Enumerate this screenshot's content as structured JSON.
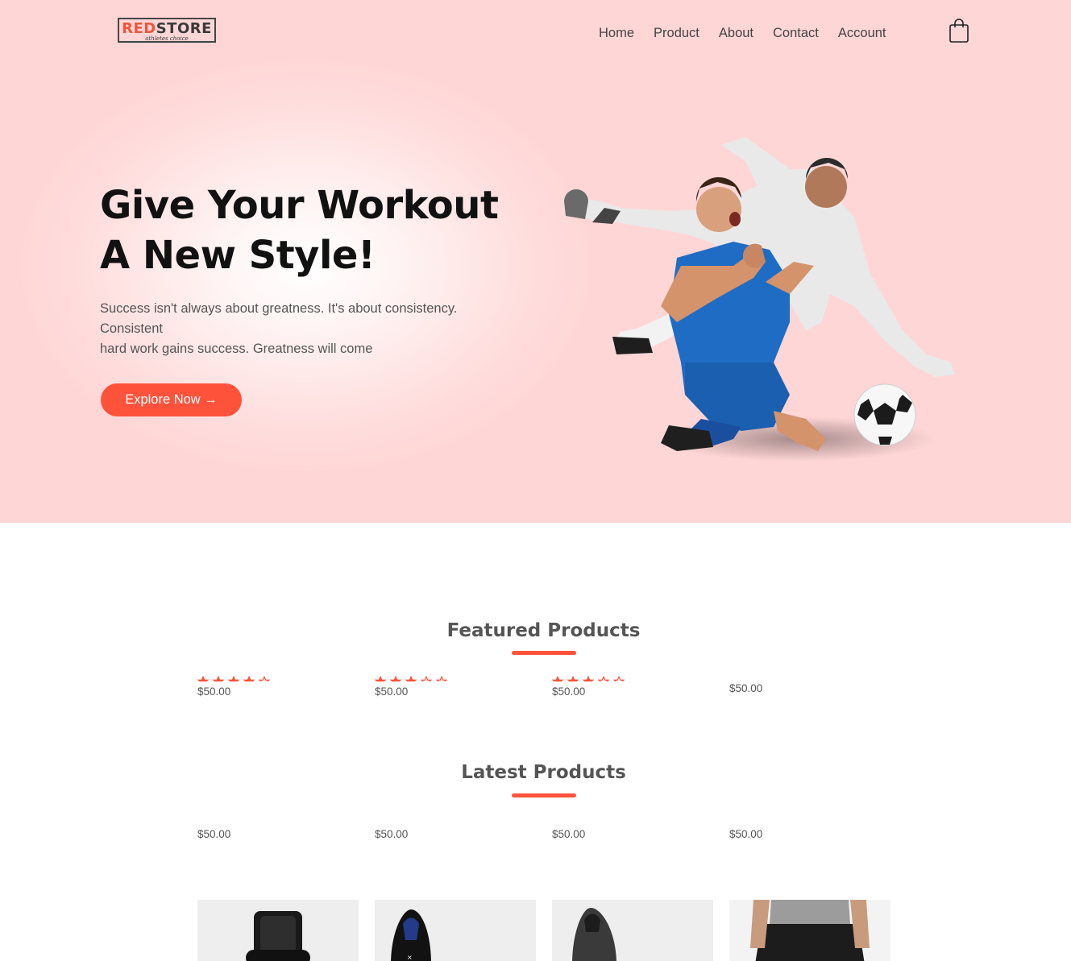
{
  "header": {
    "logo_brand_red": "RED",
    "logo_brand_dark": "STORE",
    "logo_tagline": "athletes choice",
    "nav": [
      "Home",
      "Product",
      "About",
      "Contact",
      "Account"
    ],
    "cart_icon": "shopping-bag-icon"
  },
  "hero": {
    "title_line1": "Give Your Workout",
    "title_line2": "A New Style!",
    "text_line1": "Success isn't always about greatness. It's about consistency.",
    "text_line2": "Consistent",
    "text_line3": "hard work gains success. Greatness will come",
    "button_label": "Explore Now →",
    "image": "football-players-image"
  },
  "featured": {
    "title": "Featured Products",
    "products": [
      {
        "rating": 4,
        "price": "$50.00"
      },
      {
        "rating": 3,
        "price": "$50.00"
      },
      {
        "rating": 3,
        "price": "$50.00"
      },
      {
        "rating": null,
        "price": "$50.00"
      }
    ]
  },
  "latest": {
    "title": "Latest Products",
    "products": [
      {
        "price": "$50.00"
      },
      {
        "price": "$50.00"
      },
      {
        "price": "$50.00"
      },
      {
        "price": "$50.00"
      }
    ],
    "thumbnails": [
      "smartwatch-image",
      "black-shoe-image",
      "gray-shoe-image",
      "track-pants-image"
    ]
  },
  "colors": {
    "accent": "#ff523b",
    "hero_bg": "#ffd6d6",
    "text": "#555555"
  }
}
